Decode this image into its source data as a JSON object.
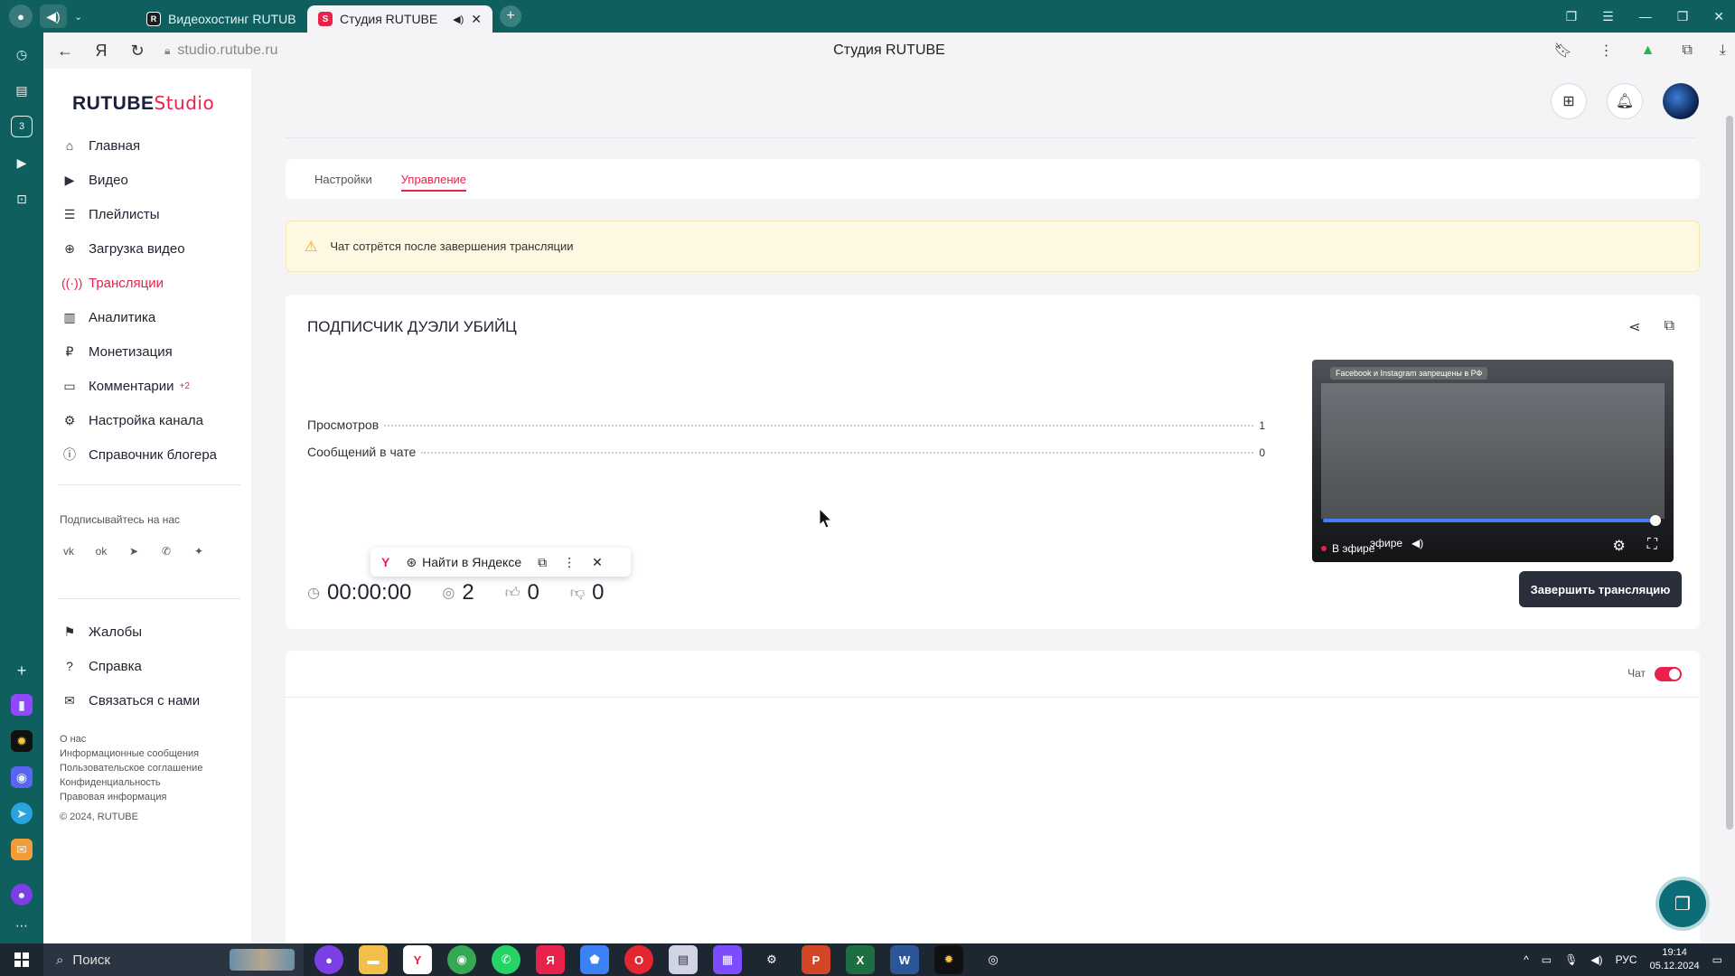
{
  "browser": {
    "tabs": [
      {
        "title": "Видеохостинг RUTUBE. С",
        "favicon": "R"
      },
      {
        "title": "Студия RUTUBE",
        "favicon": "S"
      }
    ],
    "url": "studio.rutube.ru",
    "page_title": "Студия RUTUBE"
  },
  "sidebar": {
    "logo_main": "RUTUBE",
    "logo_studio": "Studio",
    "items": [
      {
        "label": "Главная",
        "icon": "home-icon"
      },
      {
        "label": "Видео",
        "icon": "video-icon"
      },
      {
        "label": "Плейлисты",
        "icon": "playlist-icon"
      },
      {
        "label": "Загрузка видео",
        "icon": "upload-icon"
      },
      {
        "label": "Трансляции",
        "icon": "broadcast-icon"
      },
      {
        "label": "Аналитика",
        "icon": "analytics-icon"
      },
      {
        "label": "Монетизация",
        "icon": "monetization-icon"
      },
      {
        "label": "Комментарии",
        "icon": "comments-icon",
        "badge": "+2"
      },
      {
        "label": "Настройка канала",
        "icon": "settings-icon"
      },
      {
        "label": "Справочник блогера",
        "icon": "info-icon"
      }
    ],
    "follow_label": "Подписывайтесь на нас",
    "social_icons": [
      "vk-icon",
      "ok-icon",
      "telegram-icon",
      "viber-icon",
      "plus-icon"
    ],
    "items2": [
      {
        "label": "Жалобы",
        "icon": "flag-icon"
      },
      {
        "label": "Справка",
        "icon": "help-icon"
      },
      {
        "label": "Связаться с нами",
        "icon": "mail-icon"
      }
    ],
    "footer_links": [
      "О нас",
      "Информационные сообщения",
      "Пользовательское соглашение",
      "Конфиденциальность",
      "Правовая информация"
    ],
    "copyright": "© 2024, RUTUBE"
  },
  "tabs": {
    "settings": "Настройки",
    "management": "Управление"
  },
  "warning": "Чат сотрётся после завершения трансляции",
  "stream": {
    "title": "ПОДПИСЧИК ДУЭЛИ УБИЙЦ",
    "views_label": "Просмотров",
    "views_value": "1",
    "messages_label": "Сообщений в чате",
    "messages_value": "0",
    "duration": "00:00:00",
    "viewers": "2",
    "likes": "0",
    "dislikes": "0",
    "end_button": "Завершить трансляцию",
    "preview": {
      "banner": "Facebook и Instagram запрещены в РФ",
      "live_label": "В эфире",
      "overlay_text": "эфире",
      "progress": 0.98
    }
  },
  "chat": {
    "label": "Чат",
    "enabled": true
  },
  "selection_popup": {
    "search_label": "Найти в Яндексе"
  },
  "taskbar": {
    "search_placeholder": "Поиск",
    "lang": "РУС",
    "time": "19:14",
    "date": "05.12.2024"
  },
  "colors": {
    "accent": "#e8224b",
    "browser_chrome": "#0f5f5f",
    "dark_button": "#2b2f3c"
  }
}
